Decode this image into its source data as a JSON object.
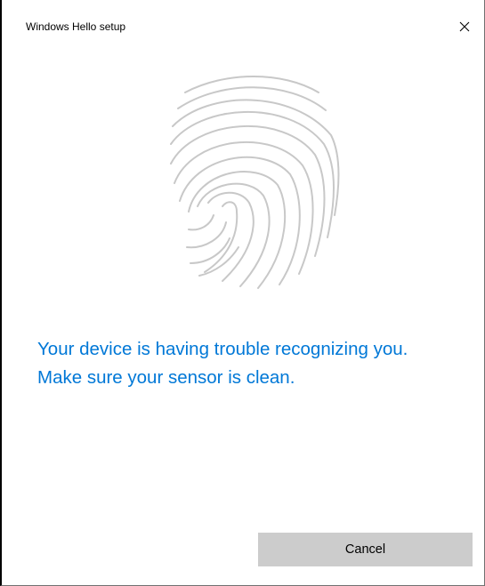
{
  "window": {
    "title": "Windows Hello setup",
    "close_icon": "close-icon"
  },
  "illustration": {
    "icon": "fingerprint-icon",
    "color": "#c8c8c8"
  },
  "message": {
    "line1": "Your device is having trouble recognizing you.",
    "line2": "Make sure your sensor is clean.",
    "color": "#0078d7"
  },
  "actions": {
    "cancel_label": "Cancel"
  }
}
